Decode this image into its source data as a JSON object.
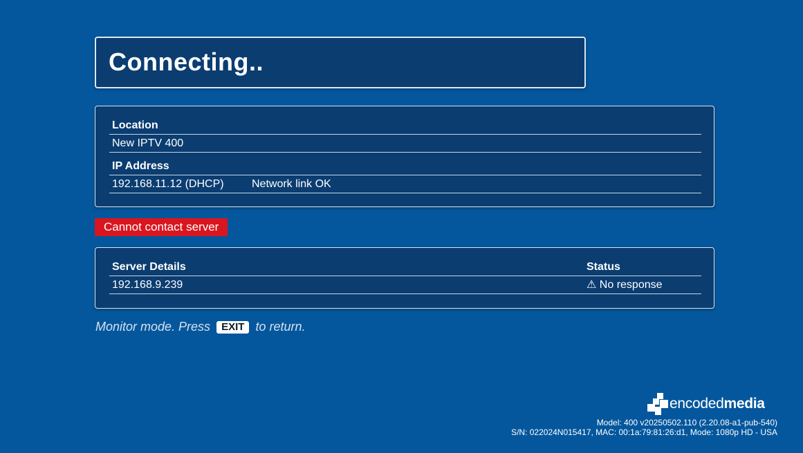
{
  "title": "Connecting..",
  "location_panel": {
    "location_label": "Location",
    "location_value": "New IPTV 400",
    "ip_label": "IP Address",
    "ip_value": "192.168.11.12 (DHCP)",
    "link_status": "Network link OK"
  },
  "error_message": "Cannot contact server",
  "server_panel": {
    "details_header": "Server Details",
    "status_header": "Status",
    "servers": [
      {
        "address": "192.168.9.239",
        "status": "⚠ No response"
      }
    ]
  },
  "monitor_note": {
    "prefix": "Monitor mode. Press",
    "key": "EXIT",
    "suffix": "to return."
  },
  "brand": {
    "name_light": "encoded",
    "name_bold": "media",
    "logo_icon": "encodedmedia-logo-icon"
  },
  "footer": {
    "model_line": "Model: 400 v20250502.110 (2.20.08-a1-pub-540)",
    "serial_line": "S/N: 022024N015417, MAC: 00:1a:79:81:26:d1, Mode: 1080p HD - USA"
  },
  "colors": {
    "background": "#04579d",
    "panel": "#0b3d71",
    "error": "#d9161f"
  }
}
